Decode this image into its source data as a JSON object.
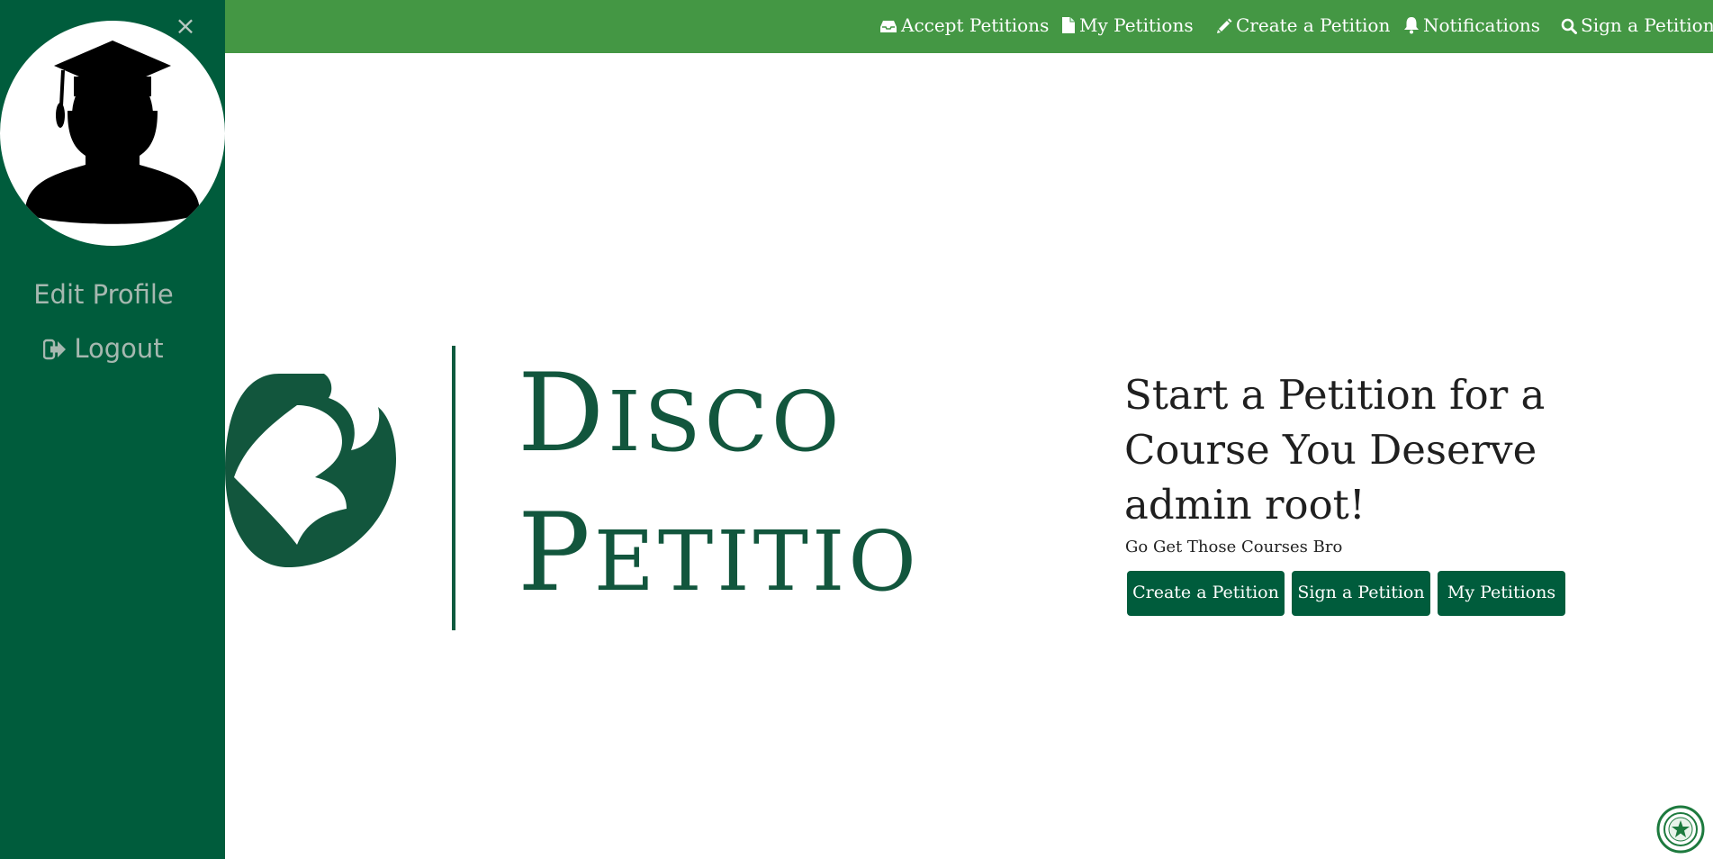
{
  "sidebar": {
    "close_label": "×",
    "avatar_icon": "graduate-silhouette",
    "edit_profile": "Edit Profile",
    "logout": "Logout"
  },
  "nav": {
    "items": [
      {
        "label": "Accept Petitions",
        "icon": "inbox-icon"
      },
      {
        "label": "My Petitions",
        "icon": "file-icon"
      },
      {
        "label": "Create a Petition",
        "icon": "pencil-icon"
      },
      {
        "label": "Notifications",
        "icon": "bell-icon"
      },
      {
        "label": "Sign a Petition",
        "icon": "search-icon"
      }
    ]
  },
  "logo": {
    "line1": {
      "initial": "D",
      "rest": "ISCO"
    },
    "line2": {
      "initial": "P",
      "rest": "ETITIO"
    }
  },
  "hero": {
    "headline_1": "Start a Petition for a",
    "headline_2": "Course You Deserve",
    "headline_3": "admin root!",
    "subtext": "Go Get Those Courses Bro",
    "buttons": [
      "Create a Petition",
      "Sign a Petition",
      "My Petitions"
    ]
  },
  "colors": {
    "sidebar": "#005c3c",
    "topnav": "#449744",
    "button": "#005c3c",
    "logo_green": "#12563d"
  }
}
